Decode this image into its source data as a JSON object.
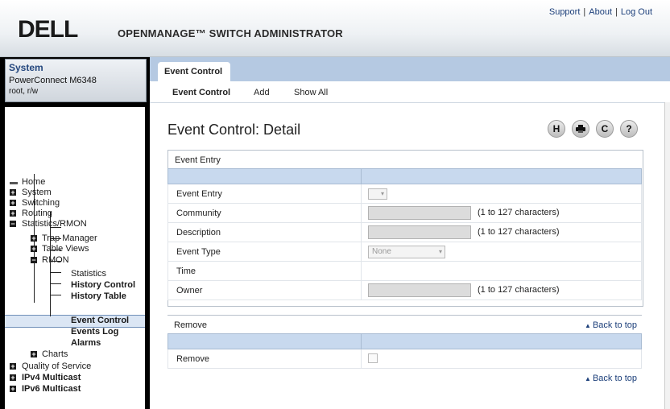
{
  "header": {
    "logo": "DELL",
    "product": "OPENMANAGE™ SWITCH ADMINISTRATOR",
    "links": [
      "Support",
      "About",
      "Log Out"
    ]
  },
  "system": {
    "title": "System",
    "model": "PowerConnect M6348",
    "user": "root, r/w"
  },
  "nav": {
    "home": "Home",
    "system": "System",
    "switching": "Switching",
    "routing": "Routing",
    "statistics": "Statistics/RMON",
    "trap_manager": "Trap Manager",
    "table_views": "Table Views",
    "rmon": "RMON",
    "rmon_statistics": "Statistics",
    "history_control": "History Control",
    "history_table": "History Table",
    "event_control": "Event Control",
    "events_log": "Events Log",
    "alarms": "Alarms",
    "charts": "Charts",
    "qos": "Quality of Service",
    "ipv4_multicast": "IPv4 Multicast",
    "ipv6_multicast": "IPv6 Multicast"
  },
  "tabs": {
    "main": "Event Control",
    "sub": [
      "Event Control",
      "Add",
      "Show All"
    ]
  },
  "page": {
    "title": "Event Control: Detail"
  },
  "toolbar_icons": [
    "save-icon",
    "print-icon",
    "refresh-icon",
    "help-icon"
  ],
  "toolbar_glyphs": {
    "save": "H",
    "refresh": "C",
    "help": "?"
  },
  "event_entry": {
    "heading": "Event Entry",
    "rows": {
      "entry": "Event Entry",
      "community": "Community",
      "community_hint": "(1 to 127 characters)",
      "description": "Description",
      "description_hint": "(1 to 127 characters)",
      "type": "Event Type",
      "type_value": "None",
      "time": "Time",
      "owner": "Owner",
      "owner_hint": "(1 to 127 characters)"
    }
  },
  "remove": {
    "heading": "Remove",
    "row_label": "Remove",
    "back_to_top": "Back to top",
    "back_to_top_2": "Back to top"
  }
}
